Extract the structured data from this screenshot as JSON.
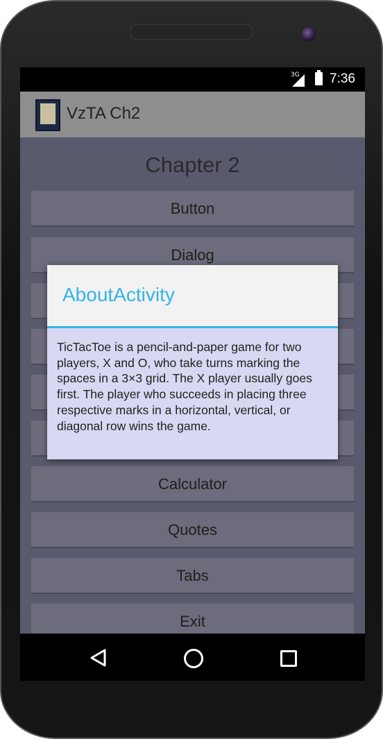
{
  "status_bar": {
    "network": "3G",
    "time": "7:36"
  },
  "action_bar": {
    "title": "VzTA Ch2",
    "icon": "app-book-icon"
  },
  "main": {
    "heading": "Chapter 2",
    "buttons": [
      {
        "label": "Button"
      },
      {
        "label": "Dialog"
      },
      {
        "label": ""
      },
      {
        "label": ""
      },
      {
        "label": ""
      },
      {
        "label": ""
      },
      {
        "label": "Calculator"
      },
      {
        "label": "Quotes"
      },
      {
        "label": "Tabs"
      },
      {
        "label": "Exit"
      }
    ]
  },
  "dialog": {
    "title": "AboutActivity",
    "message": "TicTacToe is a pencil-and-paper game for two players, X and O, who take turns marking the spaces in a 3×3 grid. The X player usually goes first. The player who succeeds in placing three respective marks in a horizontal, vertical, or diagonal row wins the game.",
    "accent_color": "#33b5e5"
  },
  "nav_bar": {
    "back_icon": "back-triangle-icon",
    "home_icon": "home-circle-icon",
    "recents_icon": "recents-square-icon"
  }
}
